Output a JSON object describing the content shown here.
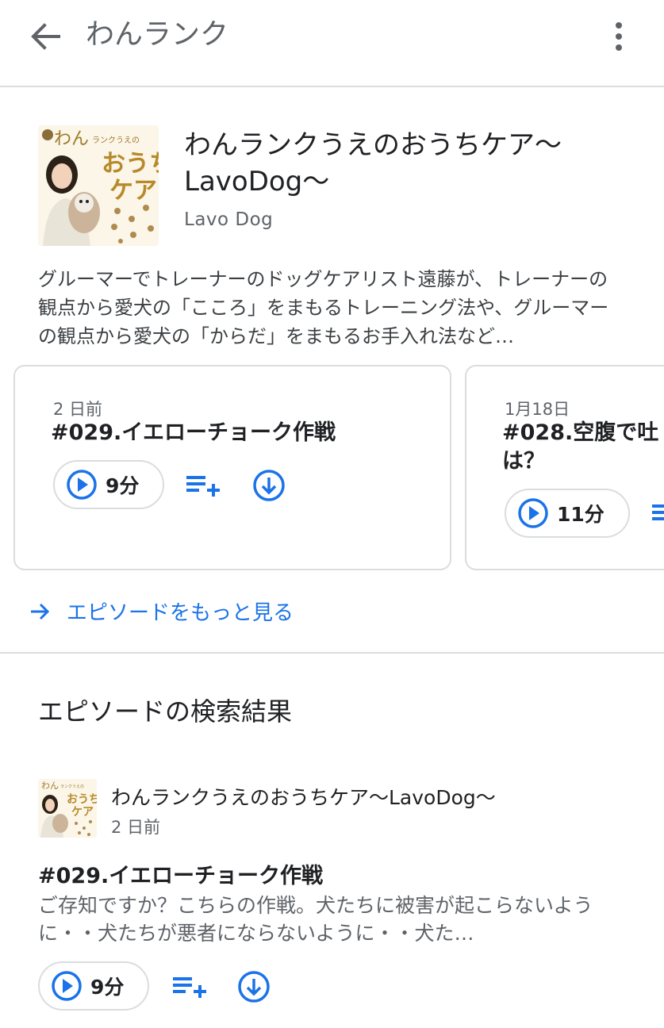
{
  "header": {
    "title": "わんランク",
    "back_icon": "arrow-back-icon",
    "more_icon": "more-vert-icon"
  },
  "podcast": {
    "title": "わんランクうえのおうちケア〜LavoDog〜",
    "author": "Lavo Dog",
    "description": "グルーマーでトレーナーのドッグケアリスト遠藤が、トレーナーの観点から愛犬の「こころ」をまもるトレーニング法や、グルーマーの観点から愛犬の「からだ」をまもるお手入れ法など…",
    "artwork": {
      "brand_prefix": "わん",
      "brand_small": "ランクうえの",
      "brand_line2": "おうち",
      "brand_line3": "ケア"
    }
  },
  "episodes": [
    {
      "date": "2 日前",
      "title": "#029.イエローチョーク作戦",
      "duration": "9分"
    },
    {
      "date": "1月18日",
      "title": "#028.空腹で吐は？",
      "duration": "11分"
    }
  ],
  "more_episodes_label": "エピソードをもっと見る",
  "search_results": {
    "heading": "エピソードの検索結果",
    "items": [
      {
        "show": "わんランクうえのおうちケア〜LavoDog〜",
        "date": "2 日前",
        "title": "#029.イエローチョーク作戦",
        "description": "ご存知ですか？こちらの作戦。犬たちに被害が起こらないように・・犬たちが悪者にならないように・・犬た…",
        "duration": "9分"
      }
    ]
  },
  "colors": {
    "accent": "#1a73e8",
    "text_primary": "#202124",
    "text_secondary": "#5f6368",
    "divider": "#dadce0"
  }
}
